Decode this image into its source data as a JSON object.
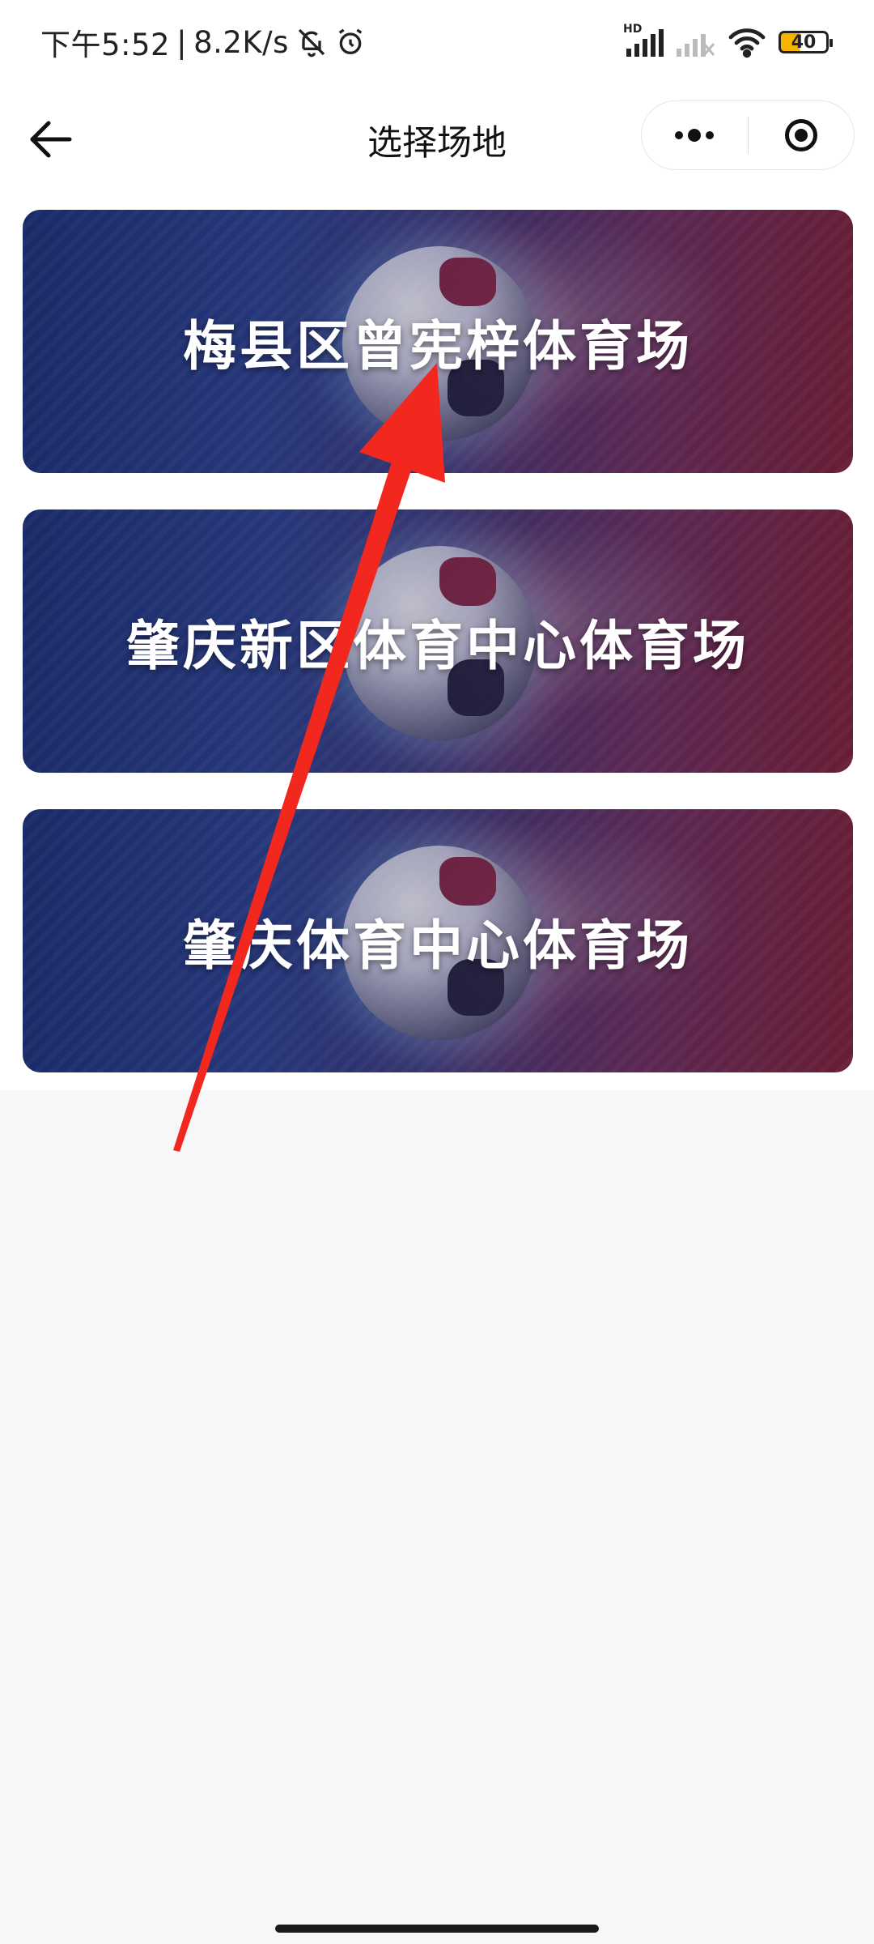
{
  "status_bar": {
    "time": "下午5:52",
    "separator": "|",
    "net_speed": "8.2K/s",
    "signal_label": "HD",
    "battery": "40",
    "icons": [
      "bell-off-icon",
      "alarm-icon",
      "signal-hd-icon",
      "signal-no-sim-icon",
      "wifi-icon",
      "battery-icon"
    ]
  },
  "nav": {
    "title": "选择场地",
    "back_icon": "arrow-left-icon",
    "more_icon": "more-dots-icon",
    "close_icon": "target-circle-icon"
  },
  "venues": [
    {
      "name": "梅县区曾宪梓体育场"
    },
    {
      "name": "肇庆新区体育中心体育场"
    },
    {
      "name": "肇庆体育中心体育场"
    }
  ],
  "colors": {
    "annotation_arrow": "#f2281e",
    "card_blue": "#1a2f73",
    "card_red": "#7a1f35",
    "page_bg": "#f7f7f7"
  }
}
